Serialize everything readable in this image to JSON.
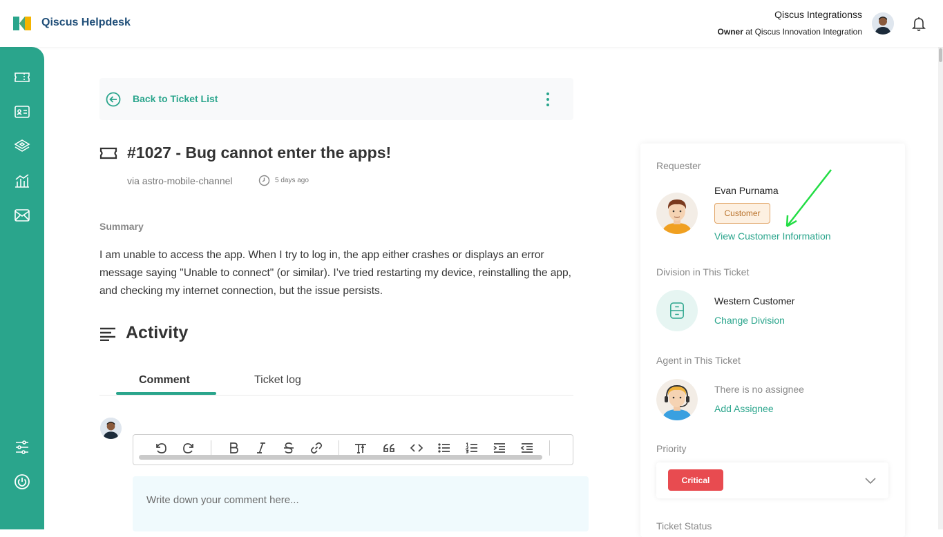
{
  "app": {
    "brand": "Qiscus Helpdesk"
  },
  "user": {
    "name": "Qiscus Integrationss",
    "role": "Owner",
    "role_suffix": " at Qiscus Innovation Integration"
  },
  "nav": {
    "back_label": "Back to Ticket List"
  },
  "ticket": {
    "title": "#1027 - Bug cannot enter the apps!",
    "via": "via astro-mobile-channel",
    "time_ago": "5 days ago",
    "summary_label": "Summary",
    "summary": "I am unable to access the app. When I try to log in, the app either crashes or displays an error message saying \"Unable to connect\" (or similar). I’ve tried restarting my device, reinstalling the app, and checking my internet connection, but the issue persists."
  },
  "activity": {
    "title": "Activity",
    "tabs": [
      {
        "label": "Comment",
        "active": true
      },
      {
        "label": "Ticket log",
        "active": false
      }
    ],
    "comment_placeholder": "Write down your comment here..."
  },
  "toolbar": {
    "buttons": [
      "undo-icon",
      "redo-icon",
      "bold-icon",
      "italic-icon",
      "strikethrough-icon",
      "link-icon",
      "heading-icon",
      "quote-icon",
      "code-icon",
      "bullet-list-icon",
      "numbered-list-icon",
      "indent-icon",
      "outdent-icon"
    ]
  },
  "panel": {
    "requester_label": "Requester",
    "requester_name": "Evan Purnama",
    "requester_badge": "Customer",
    "view_customer_link": "View Customer Information",
    "division_label": "Division in This Ticket",
    "division_name": "Western Customer",
    "change_division_link": "Change Division",
    "agent_label": "Agent in This Ticket",
    "agent_none": "There is no assignee",
    "add_assignee_link": "Add Assignee",
    "priority_label": "Priority",
    "priority_value": "Critical",
    "status_label": "Ticket Status"
  },
  "colors": {
    "accent": "#2aa58c",
    "brand_text": "#1f4e78",
    "critical": "#e84b50",
    "customer_badge": "#fdf0e1",
    "annotation_arrow": "#22dd44"
  }
}
